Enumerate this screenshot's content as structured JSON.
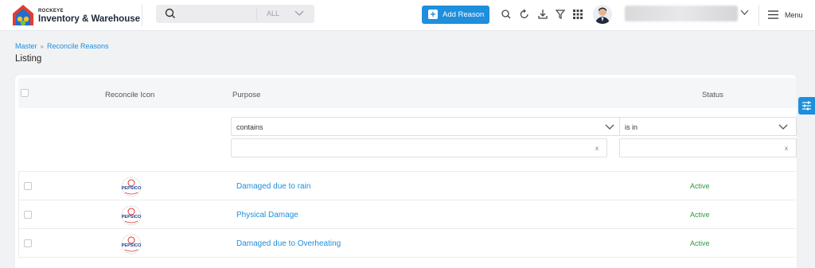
{
  "app": {
    "brand_small": "ROCKEYE",
    "brand": "Inventory & Warehouse"
  },
  "search": {
    "scope": "ALL",
    "placeholder": ""
  },
  "toolbar": {
    "add_label": "Add Reason",
    "menu_label": "Menu"
  },
  "breadcrumb": {
    "root": "Master",
    "current": "Reconcile Reasons"
  },
  "page": {
    "title": "Listing"
  },
  "table": {
    "columns": {
      "icon": "Reconcile Icon",
      "purpose": "Purpose",
      "status": "Status"
    },
    "filters": {
      "purpose_op": "contains",
      "purpose_value": "",
      "status_op": "is in",
      "status_value": "",
      "clear": "x"
    },
    "rows": [
      {
        "logo": "PEPSICO",
        "purpose": "Damaged due to rain",
        "status": "Active"
      },
      {
        "logo": "PEPSICO",
        "purpose": "Physical Damage",
        "status": "Active"
      },
      {
        "logo": "PEPSICO",
        "purpose": "Damaged due to Overheating",
        "status": "Active"
      }
    ]
  },
  "colors": {
    "accent": "#1d8fdc",
    "active": "#2e9a3e"
  }
}
